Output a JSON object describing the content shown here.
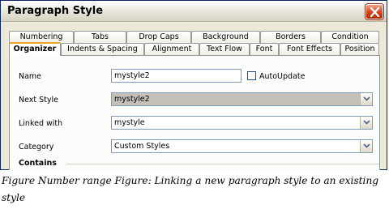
{
  "dialog": {
    "title": "Paragraph Style",
    "close_icon": "close-icon",
    "tabs_row1": [
      "Numbering",
      "Tabs",
      "Drop Caps",
      "Background",
      "Borders",
      "Condition"
    ],
    "tabs_row2": [
      "Organizer",
      "Indents & Spacing",
      "Alignment",
      "Text Flow",
      "Font",
      "Font Effects",
      "Position"
    ],
    "active_tab": "Organizer",
    "fields": {
      "name": {
        "label": "Name",
        "value": "mystyle2"
      },
      "autoupdate": {
        "label": "AutoUpdate",
        "checked": false
      },
      "next_style": {
        "label": "Next Style",
        "value": "mystyle2"
      },
      "linked_with": {
        "label": "Linked with",
        "value": "mystyle"
      },
      "category": {
        "label": "Category",
        "value": "Custom Styles"
      },
      "contains": {
        "label": "Contains"
      }
    },
    "colors": {
      "close_button": "#d4421d",
      "active_tab_accent": "#e8a535",
      "window_frame": "#0a246a"
    }
  },
  "caption": "Figure Number range Figure: Linking a new paragraph style to an existing style"
}
